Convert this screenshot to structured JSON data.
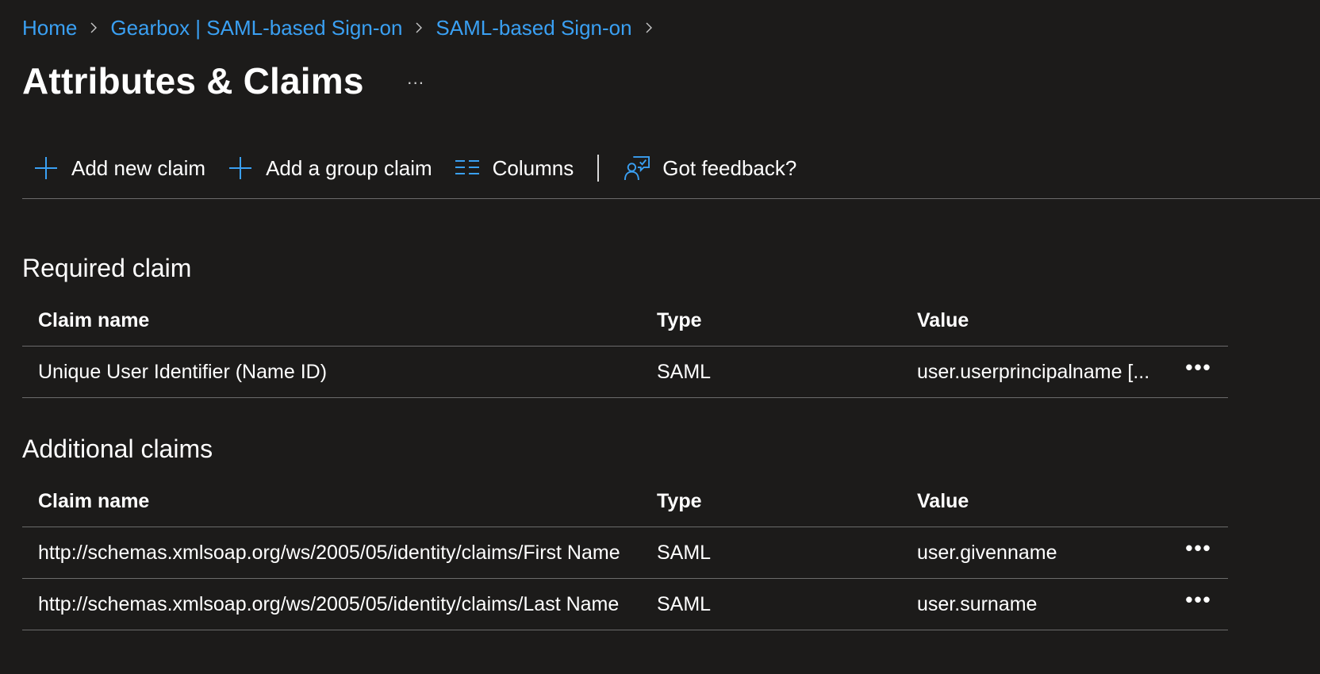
{
  "breadcrumb": {
    "items": [
      {
        "label": "Home"
      },
      {
        "label": "Gearbox | SAML-based Sign-on"
      },
      {
        "label": "SAML-based Sign-on"
      }
    ]
  },
  "header": {
    "title": "Attributes & Claims",
    "more_label": "···"
  },
  "toolbar": {
    "add_new_claim": "Add new claim",
    "add_group_claim": "Add a group claim",
    "columns": "Columns",
    "feedback": "Got feedback?"
  },
  "required": {
    "section_title": "Required claim",
    "columns": {
      "name": "Claim name",
      "type": "Type",
      "value": "Value"
    },
    "rows": [
      {
        "name": "Unique User Identifier (Name ID)",
        "type": "SAML",
        "value": "user.userprincipalname [..."
      }
    ]
  },
  "additional": {
    "section_title": "Additional claims",
    "columns": {
      "name": "Claim name",
      "type": "Type",
      "value": "Value"
    },
    "rows": [
      {
        "name": "http://schemas.xmlsoap.org/ws/2005/05/identity/claims/First Name",
        "type": "SAML",
        "value": "user.givenname"
      },
      {
        "name": "http://schemas.xmlsoap.org/ws/2005/05/identity/claims/Last Name",
        "type": "SAML",
        "value": "user.surname"
      }
    ]
  },
  "row_more_label": "•••",
  "colors": {
    "background": "#1c1b1a",
    "link": "#3aa0f3",
    "text": "#ffffff",
    "divider": "#6b6b6b"
  },
  "icons": {
    "breadcrumb_separator": "chevron-right-icon",
    "add_new_claim": "plus-icon",
    "add_group_claim": "plus-icon",
    "columns": "columns-icon",
    "feedback": "feedback-icon"
  }
}
